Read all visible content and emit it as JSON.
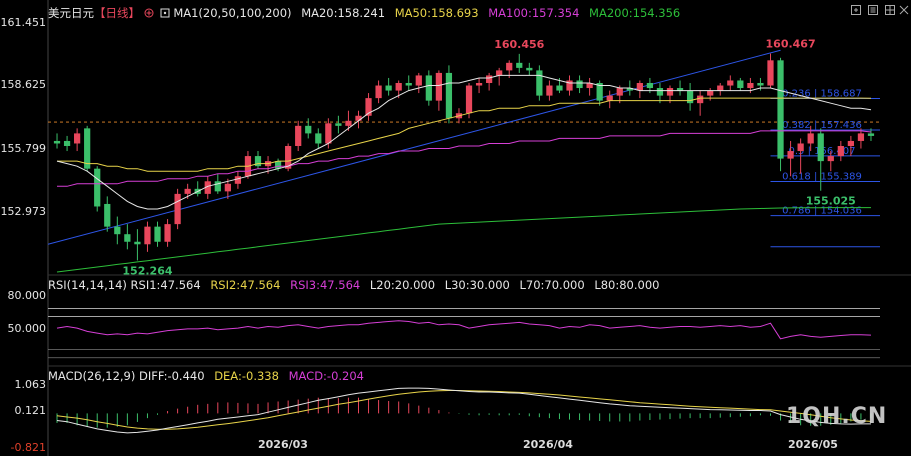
{
  "header": {
    "symbol": "美元日元",
    "period": "【日线】",
    "ma_label": "MA1(20,50,100,200)",
    "ma20": "MA20:158.241",
    "ma50": "MA50:158.693",
    "ma100": "MA100:157.354",
    "ma200": "MA200:154.356"
  },
  "rsi_header": {
    "label": "RSI(14,14,14)",
    "rsi1": "RSI1:47.564",
    "rsi2": "RSI2:47.564",
    "rsi3": "RSI3:47.564",
    "l20": "L20:20.000",
    "l30": "L30:30.000",
    "l70": "L70:70.000",
    "l80": "L80:80.000"
  },
  "macd_header": {
    "label": "MACD(26,12,9)",
    "diff": "DIFF:-0.440",
    "dea": "DEA:-0.338",
    "macd": "MACD:-0.204"
  },
  "price_axis": [
    "161.451",
    "158.625",
    "155.799",
    "152.973"
  ],
  "rsi_axis": [
    "80.000",
    "50.000"
  ],
  "macd_axis": [
    "1.063",
    "0.121",
    "-0.821"
  ],
  "x_labels": [
    "2026/03",
    "2026/04",
    "2026/05"
  ],
  "watermark": "1QH.CN",
  "colors": {
    "up": "#e8475c",
    "down": "#3bbf6a",
    "ma20": "#e6e6e6",
    "ma50": "#e8d44a",
    "ma100": "#d63fd6",
    "ma200": "#2dbf3a",
    "fib": "#2d55e6",
    "rsi": "#d63fd6"
  },
  "icons": [
    "add-icon",
    "target-icon",
    "expand-icon",
    "grid-icon",
    "settings-icon",
    "lines-icon",
    "close-icon"
  ],
  "chart_data": {
    "type": "candlestick",
    "title": "美元日元【日线】",
    "ylim": [
      151.8,
      161.8
    ],
    "annotations": {
      "high1": "160.456",
      "high2": "160.467",
      "low1": "152.264",
      "low2": "155.025"
    },
    "fib_levels": [
      {
        "label": "0.236 | 158.687",
        "value": 158.687
      },
      {
        "label": "0.382 | 157.436",
        "value": 157.436
      },
      {
        "label": "0.5 | 156.407",
        "value": 156.407
      },
      {
        "label": "0.618 | 155.389",
        "value": 155.389
      },
      {
        "label": "0.786 | 154.036",
        "value": 154.036
      }
    ],
    "candles": [
      [
        157.0,
        157.3,
        156.7,
        156.9
      ],
      [
        157.0,
        157.2,
        156.6,
        156.8
      ],
      [
        156.9,
        157.5,
        156.6,
        157.3
      ],
      [
        157.5,
        157.6,
        155.8,
        155.9
      ],
      [
        155.9,
        156.0,
        154.2,
        154.4
      ],
      [
        154.5,
        154.8,
        153.4,
        153.6
      ],
      [
        153.6,
        154.0,
        152.9,
        153.3
      ],
      [
        153.3,
        153.7,
        152.7,
        153.0
      ],
      [
        153.0,
        153.5,
        152.26,
        152.9
      ],
      [
        152.9,
        153.8,
        152.6,
        153.6
      ],
      [
        153.6,
        153.8,
        152.8,
        153.0
      ],
      [
        153.0,
        153.9,
        152.8,
        153.7
      ],
      [
        153.7,
        155.1,
        153.5,
        154.9
      ],
      [
        154.9,
        155.3,
        154.7,
        155.1
      ],
      [
        155.1,
        155.4,
        154.8,
        154.9
      ],
      [
        154.9,
        155.6,
        154.7,
        155.4
      ],
      [
        155.4,
        155.7,
        154.9,
        155.0
      ],
      [
        155.0,
        155.5,
        154.7,
        155.3
      ],
      [
        155.3,
        155.8,
        155.1,
        155.6
      ],
      [
        155.6,
        156.6,
        155.5,
        156.4
      ],
      [
        156.4,
        156.6,
        155.9,
        156.0
      ],
      [
        156.0,
        156.4,
        155.7,
        156.2
      ],
      [
        156.2,
        156.3,
        155.8,
        155.9
      ],
      [
        155.9,
        156.9,
        155.8,
        156.8
      ],
      [
        156.8,
        157.8,
        156.6,
        157.6
      ],
      [
        157.6,
        157.9,
        157.1,
        157.3
      ],
      [
        157.3,
        157.5,
        156.7,
        156.9
      ],
      [
        156.9,
        157.9,
        156.7,
        157.7
      ],
      [
        157.7,
        158.0,
        157.3,
        157.6
      ],
      [
        157.6,
        158.2,
        157.4,
        157.8
      ],
      [
        157.8,
        158.2,
        157.5,
        158.0
      ],
      [
        158.0,
        158.9,
        157.8,
        158.7
      ],
      [
        158.7,
        159.4,
        158.5,
        159.2
      ],
      [
        159.2,
        159.5,
        158.8,
        159.0
      ],
      [
        159.0,
        159.4,
        158.7,
        159.3
      ],
      [
        159.3,
        159.6,
        159.0,
        159.2
      ],
      [
        159.2,
        159.7,
        158.9,
        159.6
      ],
      [
        159.6,
        159.8,
        158.4,
        158.6
      ],
      [
        158.6,
        159.8,
        158.2,
        159.7
      ],
      [
        159.7,
        160.0,
        157.7,
        157.9
      ],
      [
        157.9,
        158.3,
        157.7,
        158.1
      ],
      [
        158.1,
        159.3,
        157.9,
        159.2
      ],
      [
        159.2,
        159.5,
        158.9,
        159.3
      ],
      [
        159.3,
        159.7,
        159.0,
        159.6
      ],
      [
        159.6,
        159.9,
        159.2,
        159.8
      ],
      [
        159.8,
        160.2,
        159.5,
        160.1
      ],
      [
        160.1,
        160.456,
        159.7,
        159.9
      ],
      [
        159.9,
        160.1,
        159.6,
        159.8
      ],
      [
        159.8,
        160.0,
        158.6,
        158.8
      ],
      [
        158.8,
        159.4,
        158.6,
        159.2
      ],
      [
        159.2,
        159.5,
        158.9,
        159.0
      ],
      [
        159.0,
        159.6,
        158.8,
        159.4
      ],
      [
        159.4,
        159.6,
        158.9,
        159.1
      ],
      [
        159.1,
        159.5,
        158.8,
        159.3
      ],
      [
        159.3,
        159.4,
        158.4,
        158.6
      ],
      [
        158.6,
        159.0,
        158.3,
        158.8
      ],
      [
        158.8,
        159.2,
        158.5,
        159.1
      ],
      [
        159.1,
        159.4,
        158.8,
        159.0
      ],
      [
        159.0,
        159.4,
        158.7,
        159.3
      ],
      [
        159.3,
        159.5,
        158.9,
        159.1
      ],
      [
        159.1,
        159.3,
        158.5,
        158.8
      ],
      [
        158.8,
        159.2,
        158.5,
        159.1
      ],
      [
        159.1,
        159.4,
        158.8,
        159.0
      ],
      [
        159.0,
        159.3,
        158.2,
        158.5
      ],
      [
        158.5,
        159.0,
        158.0,
        158.8
      ],
      [
        158.8,
        159.1,
        158.6,
        159.0
      ],
      [
        159.0,
        159.3,
        158.8,
        159.2
      ],
      [
        159.2,
        159.6,
        159.0,
        159.4
      ],
      [
        159.4,
        159.5,
        159.0,
        159.1
      ],
      [
        159.1,
        159.5,
        158.9,
        159.3
      ],
      [
        159.3,
        159.5,
        159.0,
        159.2
      ],
      [
        159.2,
        160.467,
        159.1,
        160.2
      ],
      [
        160.2,
        160.3,
        155.8,
        156.3
      ],
      [
        156.3,
        157.0,
        155.6,
        156.6
      ],
      [
        156.6,
        157.1,
        155.7,
        156.9
      ],
      [
        156.9,
        157.6,
        156.6,
        157.3
      ],
      [
        157.3,
        157.5,
        155.025,
        156.2
      ],
      [
        156.2,
        156.6,
        155.8,
        156.4
      ],
      [
        156.4,
        157.0,
        156.2,
        156.8
      ],
      [
        156.8,
        157.2,
        156.4,
        157.0
      ],
      [
        157.0,
        157.5,
        156.7,
        157.3
      ],
      [
        157.3,
        157.5,
        157.0,
        157.2
      ]
    ],
    "ma20": [
      156.2,
      156.1,
      156.0,
      155.8,
      155.5,
      155.2,
      154.9,
      154.6,
      154.4,
      154.3,
      154.3,
      154.4,
      154.6,
      154.8,
      155.0,
      155.2,
      155.3,
      155.4,
      155.5,
      155.6,
      155.7,
      155.8,
      155.9,
      156.0,
      156.2,
      156.5,
      156.7,
      156.9,
      157.2,
      157.5,
      157.8,
      158.1,
      158.3,
      158.6,
      158.8,
      159.0,
      159.1,
      159.2,
      159.2,
      159.3,
      159.3,
      159.4,
      159.5,
      159.5,
      159.6,
      159.6,
      159.6,
      159.6,
      159.6,
      159.5,
      159.4,
      159.3,
      159.3,
      159.3,
      159.2,
      159.2,
      159.1,
      159.1,
      159.0,
      159.0,
      159.0,
      159.0,
      159.0,
      159.0,
      159.0,
      159.0,
      159.0,
      159.0,
      159.0,
      159.0,
      159.1,
      159.1,
      159.0,
      158.9,
      158.8,
      158.7,
      158.6,
      158.5,
      158.4,
      158.3,
      158.3,
      158.241
    ],
    "ma50": [
      156.2,
      156.2,
      156.2,
      156.1,
      156.1,
      156.0,
      156.0,
      155.9,
      155.9,
      155.8,
      155.8,
      155.8,
      155.8,
      155.8,
      155.8,
      155.9,
      155.9,
      155.9,
      156.0,
      156.0,
      156.1,
      156.1,
      156.2,
      156.2,
      156.3,
      156.4,
      156.5,
      156.6,
      156.7,
      156.8,
      156.9,
      157.0,
      157.1,
      157.2,
      157.3,
      157.5,
      157.6,
      157.7,
      157.8,
      157.9,
      158.0,
      158.1,
      158.2,
      158.2,
      158.3,
      158.3,
      158.3,
      158.4,
      158.4,
      158.4,
      158.5,
      158.5,
      158.5,
      158.5,
      158.5,
      158.6,
      158.6,
      158.6,
      158.6,
      158.6,
      158.6,
      158.6,
      158.6,
      158.6,
      158.7,
      158.7,
      158.7,
      158.7,
      158.7,
      158.7,
      158.7,
      158.7,
      158.7,
      158.7,
      158.7,
      158.7,
      158.7,
      158.7,
      158.7,
      158.7,
      158.7,
      158.693
    ],
    "ma100": [
      155.2,
      155.2,
      155.3,
      155.3,
      155.3,
      155.3,
      155.3,
      155.4,
      155.4,
      155.4,
      155.4,
      155.5,
      155.5,
      155.5,
      155.6,
      155.6,
      155.7,
      155.7,
      155.8,
      155.8,
      155.9,
      155.9,
      156.0,
      156.0,
      156.1,
      156.1,
      156.2,
      156.2,
      156.3,
      156.3,
      156.4,
      156.4,
      156.5,
      156.5,
      156.6,
      156.6,
      156.6,
      156.7,
      156.7,
      156.7,
      156.8,
      156.8,
      156.8,
      156.9,
      156.9,
      156.9,
      157.0,
      157.0,
      157.0,
      157.0,
      157.1,
      157.1,
      157.1,
      157.1,
      157.1,
      157.2,
      157.2,
      157.2,
      157.2,
      157.2,
      157.2,
      157.3,
      157.3,
      157.3,
      157.3,
      157.3,
      157.3,
      157.3,
      157.3,
      157.3,
      157.4,
      157.4,
      157.4,
      157.4,
      157.4,
      157.4,
      157.4,
      157.4,
      157.4,
      157.4,
      157.4,
      157.354
    ],
    "ma200": [
      151.8,
      151.85,
      151.9,
      151.95,
      152.0,
      152.05,
      152.1,
      152.15,
      152.2,
      152.25,
      152.3,
      152.35,
      152.4,
      152.45,
      152.5,
      152.55,
      152.6,
      152.65,
      152.7,
      152.75,
      152.8,
      152.85,
      152.9,
      152.95,
      153.0,
      153.05,
      153.1,
      153.15,
      153.2,
      153.25,
      153.3,
      153.35,
      153.4,
      153.45,
      153.5,
      153.55,
      153.6,
      153.65,
      153.7,
      153.72,
      153.74,
      153.76,
      153.78,
      153.8,
      153.82,
      153.84,
      153.86,
      153.88,
      153.9,
      153.92,
      153.94,
      153.96,
      153.98,
      154.0,
      154.02,
      154.04,
      154.06,
      154.08,
      154.1,
      154.12,
      154.14,
      154.16,
      154.18,
      154.2,
      154.22,
      154.24,
      154.26,
      154.28,
      154.3,
      154.31,
      154.32,
      154.33,
      154.34,
      154.345,
      154.35,
      154.352,
      154.353,
      154.354,
      154.355,
      154.356,
      154.356,
      154.356
    ],
    "rsi": [
      56,
      58,
      56,
      52,
      50,
      48,
      49,
      48,
      50,
      49,
      51,
      53,
      54,
      55,
      55,
      56,
      54,
      55,
      56,
      58,
      56,
      58,
      57,
      59,
      60,
      58,
      56,
      58,
      59,
      60,
      60,
      62,
      63,
      64,
      65,
      64,
      62,
      63,
      60,
      61,
      60,
      56,
      58,
      60,
      61,
      62,
      63,
      61,
      60,
      59,
      56,
      58,
      57,
      60,
      59,
      56,
      57,
      58,
      59,
      57,
      56,
      57,
      58,
      58,
      57,
      58,
      59,
      58,
      59,
      57,
      58,
      62,
      43,
      46,
      48,
      46,
      45,
      46,
      47,
      48,
      48,
      47.564
    ],
    "macd_diff": [
      -0.3,
      -0.35,
      -0.45,
      -0.55,
      -0.65,
      -0.72,
      -0.78,
      -0.82,
      -0.8,
      -0.75,
      -0.7,
      -0.62,
      -0.55,
      -0.48,
      -0.4,
      -0.33,
      -0.25,
      -0.2,
      -0.15,
      -0.1,
      -0.05,
      0.05,
      0.15,
      0.25,
      0.35,
      0.45,
      0.55,
      0.62,
      0.7,
      0.78,
      0.85,
      0.9,
      0.95,
      1.0,
      1.05,
      1.06,
      1.063,
      1.05,
      1.02,
      0.98,
      0.95,
      0.92,
      0.9,
      0.9,
      0.88,
      0.86,
      0.85,
      0.8,
      0.75,
      0.7,
      0.65,
      0.6,
      0.55,
      0.5,
      0.45,
      0.4,
      0.36,
      0.32,
      0.3,
      0.28,
      0.26,
      0.24,
      0.22,
      0.2,
      0.18,
      0.16,
      0.15,
      0.14,
      0.13,
      0.12,
      0.121,
      0.1,
      -0.05,
      -0.15,
      -0.25,
      -0.32,
      -0.38,
      -0.42,
      -0.44,
      -0.45,
      -0.44,
      -0.44
    ],
    "macd_dea": [
      -0.1,
      -0.15,
      -0.2,
      -0.27,
      -0.35,
      -0.42,
      -0.5,
      -0.57,
      -0.62,
      -0.65,
      -0.67,
      -0.67,
      -0.65,
      -0.62,
      -0.58,
      -0.53,
      -0.48,
      -0.43,
      -0.37,
      -0.31,
      -0.25,
      -0.18,
      -0.1,
      -0.02,
      0.06,
      0.14,
      0.22,
      0.3,
      0.38,
      0.45,
      0.52,
      0.6,
      0.67,
      0.74,
      0.8,
      0.85,
      0.9,
      0.93,
      0.95,
      0.96,
      0.96,
      0.95,
      0.94,
      0.93,
      0.92,
      0.9,
      0.88,
      0.86,
      0.83,
      0.8,
      0.77,
      0.73,
      0.69,
      0.65,
      0.61,
      0.57,
      0.53,
      0.49,
      0.45,
      0.42,
      0.39,
      0.36,
      0.33,
      0.3,
      0.28,
      0.26,
      0.24,
      0.22,
      0.2,
      0.18,
      0.16,
      0.15,
      0.1,
      0.05,
      0.0,
      -0.06,
      -0.12,
      -0.18,
      -0.23,
      -0.28,
      -0.31,
      -0.338
    ]
  }
}
